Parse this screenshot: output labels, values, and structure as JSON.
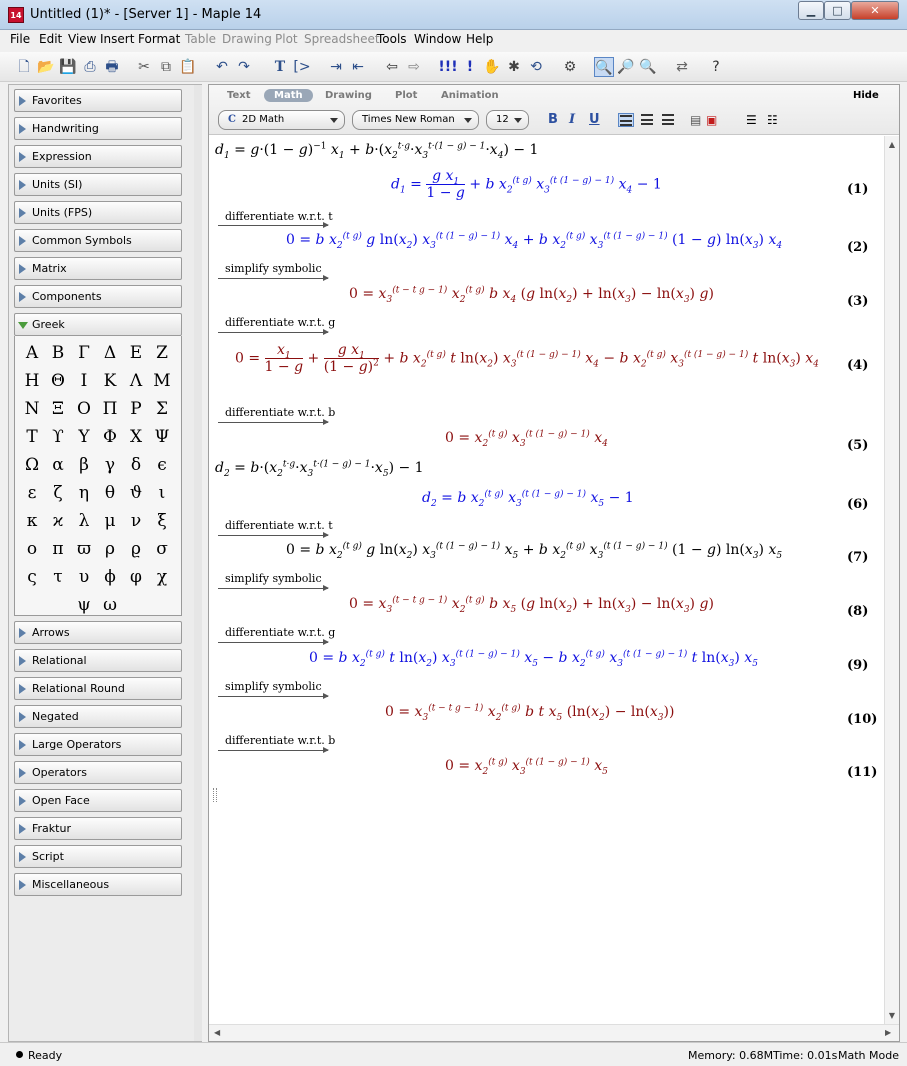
{
  "window": {
    "title": "Untitled (1)* - [Server 1] - Maple 14",
    "icon_label": "14"
  },
  "menu": [
    "File",
    "Edit",
    "View",
    "Insert",
    "Format",
    "Table",
    "Drawing",
    "Plot",
    "Spreadsheet",
    "Tools",
    "Window",
    "Help"
  ],
  "menu_disabled": [
    "Table",
    "Drawing",
    "Plot",
    "Spreadsheet"
  ],
  "palettes": {
    "top": [
      "Favorites",
      "Handwriting",
      "Expression",
      "Units (SI)",
      "Units (FPS)",
      "Common Symbols",
      "Matrix",
      "Components",
      "Greek"
    ],
    "greek_symbols": [
      "Α",
      "Β",
      "Γ",
      "Δ",
      "Ε",
      "Ζ",
      "Η",
      "Θ",
      "Ι",
      "Κ",
      "Λ",
      "Μ",
      "Ν",
      "Ξ",
      "Ο",
      "Π",
      "Ρ",
      "Σ",
      "Τ",
      "ϒ",
      "Υ",
      "Φ",
      "Χ",
      "Ψ",
      "Ω",
      "α",
      "β",
      "γ",
      "δ",
      "ϵ",
      "ε",
      "ζ",
      "η",
      "θ",
      "ϑ",
      "ι",
      "κ",
      "ϰ",
      "λ",
      "μ",
      "ν",
      "ξ",
      "ο",
      "π",
      "ϖ",
      "ρ",
      "ϱ",
      "σ",
      "ς",
      "τ",
      "υ",
      "ϕ",
      "φ",
      "χ",
      "ψ",
      "ω"
    ],
    "bottom": [
      "Arrows",
      "Relational",
      "Relational Round",
      "Negated",
      "Large Operators",
      "Operators",
      "Open Face",
      "Fraktur",
      "Script",
      "Miscellaneous"
    ]
  },
  "context_bar": {
    "modes": [
      "Text",
      "Math",
      "Drawing",
      "Plot",
      "Animation"
    ],
    "active_mode": "Math",
    "hide": "Hide",
    "math_type": "2D Math",
    "font": "Times New Roman",
    "size": "12",
    "bold": "B",
    "italic": "I",
    "underline": "U"
  },
  "worksheet": {
    "labels": {
      "diff_t": "differentiate w.r.t. t",
      "simplify": "simplify symbolic",
      "diff_g": "differentiate w.r.t. g",
      "diff_b": "differentiate w.r.t. b"
    },
    "eq_numbers": [
      "(1)",
      "(2)",
      "(3)",
      "(4)",
      "(5)",
      "(6)",
      "(7)",
      "(8)",
      "(9)",
      "(10)",
      "(11)"
    ]
  },
  "status": {
    "ready": "Ready",
    "memory": "Memory: 0.68M",
    "time": "Time: 0.01s",
    "mode": "Math Mode"
  }
}
